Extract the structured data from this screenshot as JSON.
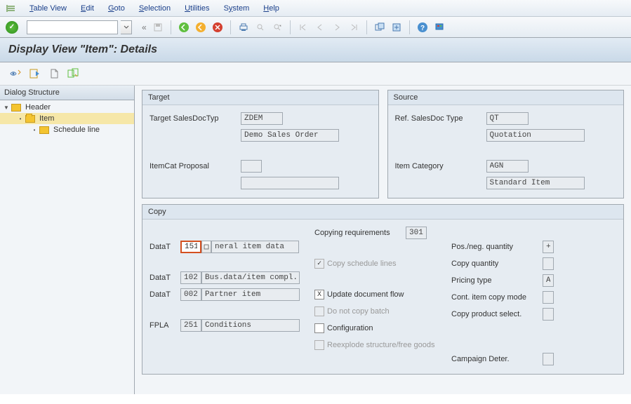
{
  "menubar": {
    "items": [
      "Table View",
      "Edit",
      "Goto",
      "Selection",
      "Utilities",
      "System",
      "Help"
    ]
  },
  "title": "Display View \"Item\": Details",
  "sidebar": {
    "header": "Dialog Structure",
    "tree": [
      {
        "label": "Header",
        "level": 0,
        "expanded": true,
        "selected": false
      },
      {
        "label": "Item",
        "level": 1,
        "expanded": true,
        "selected": true
      },
      {
        "label": "Schedule line",
        "level": 2,
        "expanded": false,
        "selected": false
      }
    ]
  },
  "target": {
    "header": "Target",
    "sales_doc_type_label": "Target SalesDocTyp",
    "sales_doc_type_value": "ZDEM",
    "sales_doc_type_desc": "Demo Sales Order",
    "itemcat_label": "ItemCat Proposal",
    "itemcat_value": "",
    "itemcat_desc": ""
  },
  "source": {
    "header": "Source",
    "sales_doc_type_label": "Ref. SalesDoc Type",
    "sales_doc_type_value": "QT",
    "sales_doc_type_desc": "Quotation",
    "item_cat_label": "Item Category",
    "item_cat_value": "AGN",
    "item_cat_desc": "Standard Item"
  },
  "copy": {
    "header": "Copy",
    "datat_label": "DataT",
    "datat1_value": "151",
    "datat1_desc": "neral item data",
    "datat2_value": "102",
    "datat2_desc": "Bus.data/item compl.",
    "datat3_value": "002",
    "datat3_desc": "Partner item",
    "fpla_label": "FPLA",
    "fpla_value": "251",
    "fpla_desc": "Conditions",
    "copying_req_label": "Copying requirements",
    "copying_req_value": "301",
    "copy_schedule_lines": "Copy schedule lines",
    "update_doc_flow": "Update document flow",
    "update_doc_flow_value": "X",
    "do_not_copy_batch": "Do not copy batch",
    "configuration": "Configuration",
    "reexplode": "Reexplode structure/free goods",
    "pos_neg_qty": "Pos./neg. quantity",
    "pos_neg_qty_value": "+",
    "copy_quantity": "Copy quantity",
    "pricing_type": "Pricing type",
    "pricing_type_value": "A",
    "cont_item_copy": "Cont. item copy mode",
    "copy_product_select": "Copy product select.",
    "campaign_deter": "Campaign Deter."
  }
}
